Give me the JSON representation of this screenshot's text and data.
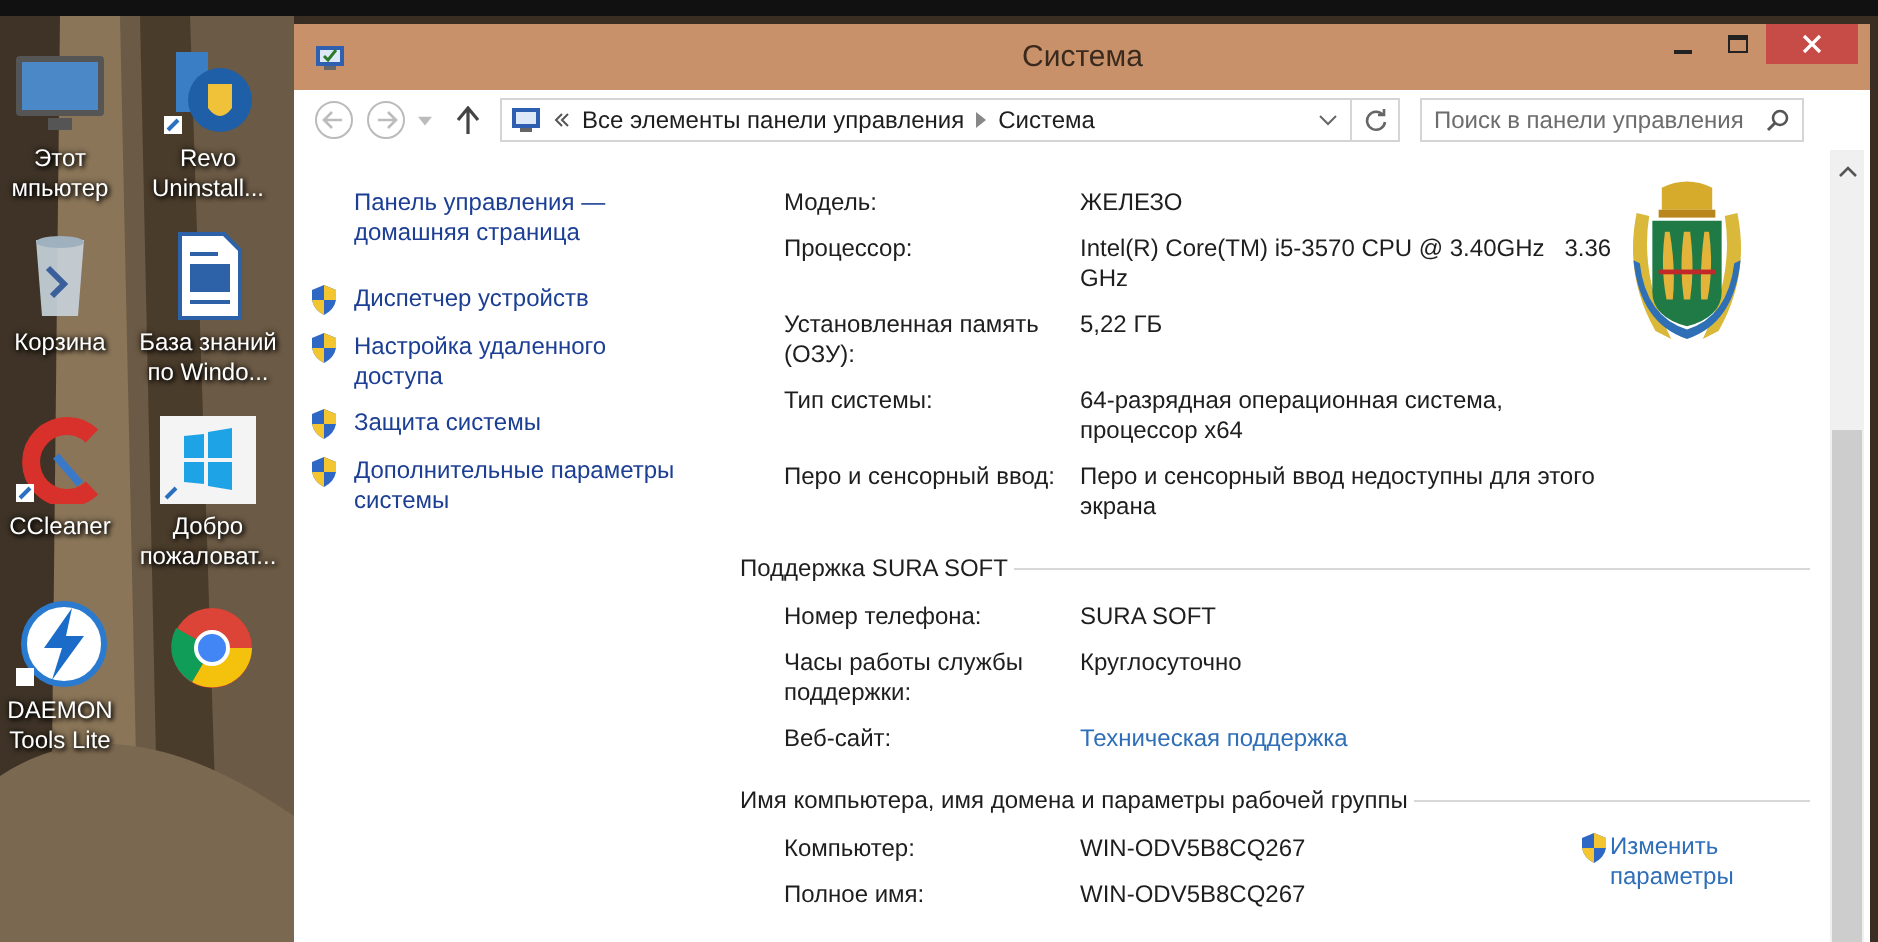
{
  "desktop": {
    "icons": [
      {
        "kind": "computer",
        "label": "Этот мпьютер"
      },
      {
        "kind": "installer",
        "label": "Revo Uninstall..."
      },
      {
        "kind": "trash",
        "label": "Корзина"
      },
      {
        "kind": "document",
        "label": "База знаний по Windo..."
      },
      {
        "kind": "cleaner",
        "label": "CCleaner"
      },
      {
        "kind": "tiles",
        "label": "Добро пожаловат..."
      },
      {
        "kind": "lightning",
        "label": "DAEMON Tools Lite"
      },
      {
        "kind": "round"
      }
    ]
  },
  "window": {
    "title": "Система",
    "address_bar": {
      "breadcrumb": [
        "Все элементы панели управления",
        "Система"
      ]
    },
    "search": {
      "placeholder": "Поиск в панели управления"
    },
    "sidebar": {
      "home_link": "Панель управления — домашняя страница",
      "items": [
        {
          "label": "Диспетчер устройств"
        },
        {
          "label": "Настройка удаленного доступа"
        },
        {
          "label": "Защита системы"
        },
        {
          "label": "Дополнительные параметры системы"
        }
      ]
    },
    "sections": [
      {
        "rows": [
          {
            "label": "Модель:",
            "value": "ЖЕЛЕЗО",
            "kind": "text"
          },
          {
            "label": "Процессор:",
            "value": "Intel(R) Core(TM) i5-3570 CPU @ 3.40GHz   3.36 GHz",
            "kind": "text"
          },
          {
            "label": "Установленная память (ОЗУ):",
            "value": "5,22 ГБ",
            "kind": "text"
          },
          {
            "label": "Тип системы:",
            "value": "64-разрядная операционная система, процессор x64",
            "kind": "text"
          },
          {
            "label": "Перо и сенсорный ввод:",
            "value": "Перо и сенсорный ввод недоступны для этого экрана",
            "kind": "text"
          }
        ]
      },
      {
        "heading": "Поддержка SURA SOFT",
        "rows": [
          {
            "label": "Номер телефона:",
            "value": "SURA SOFT",
            "kind": "text"
          },
          {
            "label": "Часы работы службы поддержки:",
            "value": "Круглосуточно",
            "kind": "text"
          },
          {
            "label": "Веб-сайт:",
            "value": "Техническая поддержка",
            "kind": "link"
          }
        ]
      },
      {
        "heading": "Имя компьютера, имя домена и параметры рабочей группы",
        "action": "Изменить параметры",
        "rows": [
          {
            "label": "Компьютер:",
            "value": "WIN-ODV5B8CQ267",
            "kind": "text"
          },
          {
            "label": "Полное имя:",
            "value": "WIN-ODV5B8CQ267",
            "kind": "text"
          }
        ]
      }
    ]
  }
}
